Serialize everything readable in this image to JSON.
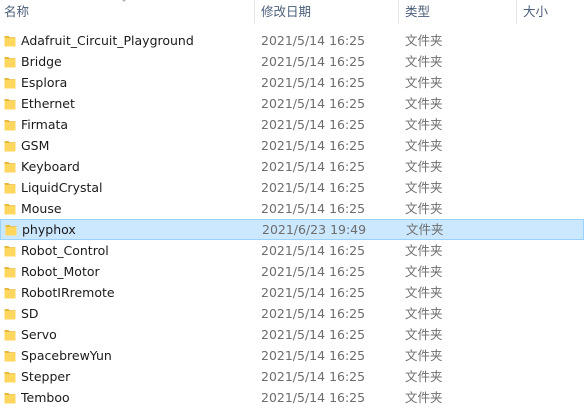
{
  "columns": {
    "name": "名称",
    "date": "修改日期",
    "type": "类型",
    "size": "大小"
  },
  "rows": [
    {
      "name": "Adafruit_Circuit_Playground",
      "date": "2021/5/14 16:25",
      "type": "文件夹",
      "size": ""
    },
    {
      "name": "Bridge",
      "date": "2021/5/14 16:25",
      "type": "文件夹",
      "size": ""
    },
    {
      "name": "Esplora",
      "date": "2021/5/14 16:25",
      "type": "文件夹",
      "size": ""
    },
    {
      "name": "Ethernet",
      "date": "2021/5/14 16:25",
      "type": "文件夹",
      "size": ""
    },
    {
      "name": "Firmata",
      "date": "2021/5/14 16:25",
      "type": "文件夹",
      "size": ""
    },
    {
      "name": "GSM",
      "date": "2021/5/14 16:25",
      "type": "文件夹",
      "size": ""
    },
    {
      "name": "Keyboard",
      "date": "2021/5/14 16:25",
      "type": "文件夹",
      "size": ""
    },
    {
      "name": "LiquidCrystal",
      "date": "2021/5/14 16:25",
      "type": "文件夹",
      "size": ""
    },
    {
      "name": "Mouse",
      "date": "2021/5/14 16:25",
      "type": "文件夹",
      "size": ""
    },
    {
      "name": "phyphox",
      "date": "2021/6/23 19:49",
      "type": "文件夹",
      "size": "",
      "selected": true
    },
    {
      "name": "Robot_Control",
      "date": "2021/5/14 16:25",
      "type": "文件夹",
      "size": ""
    },
    {
      "name": "Robot_Motor",
      "date": "2021/5/14 16:25",
      "type": "文件夹",
      "size": ""
    },
    {
      "name": "RobotIRremote",
      "date": "2021/5/14 16:25",
      "type": "文件夹",
      "size": ""
    },
    {
      "name": "SD",
      "date": "2021/5/14 16:25",
      "type": "文件夹",
      "size": ""
    },
    {
      "name": "Servo",
      "date": "2021/5/14 16:25",
      "type": "文件夹",
      "size": ""
    },
    {
      "name": "SpacebrewYun",
      "date": "2021/5/14 16:25",
      "type": "文件夹",
      "size": ""
    },
    {
      "name": "Stepper",
      "date": "2021/5/14 16:25",
      "type": "文件夹",
      "size": ""
    },
    {
      "name": "Temboo",
      "date": "2021/5/14 16:25",
      "type": "文件夹",
      "size": ""
    }
  ],
  "colors": {
    "selected_bg": "#cce8ff",
    "selected_border": "#99d1ff",
    "folder_fill": "#ffd75e",
    "folder_tab": "#e8b83d"
  },
  "icons": {
    "folder": "folder-icon",
    "sort": "sort-arrow-icon"
  }
}
